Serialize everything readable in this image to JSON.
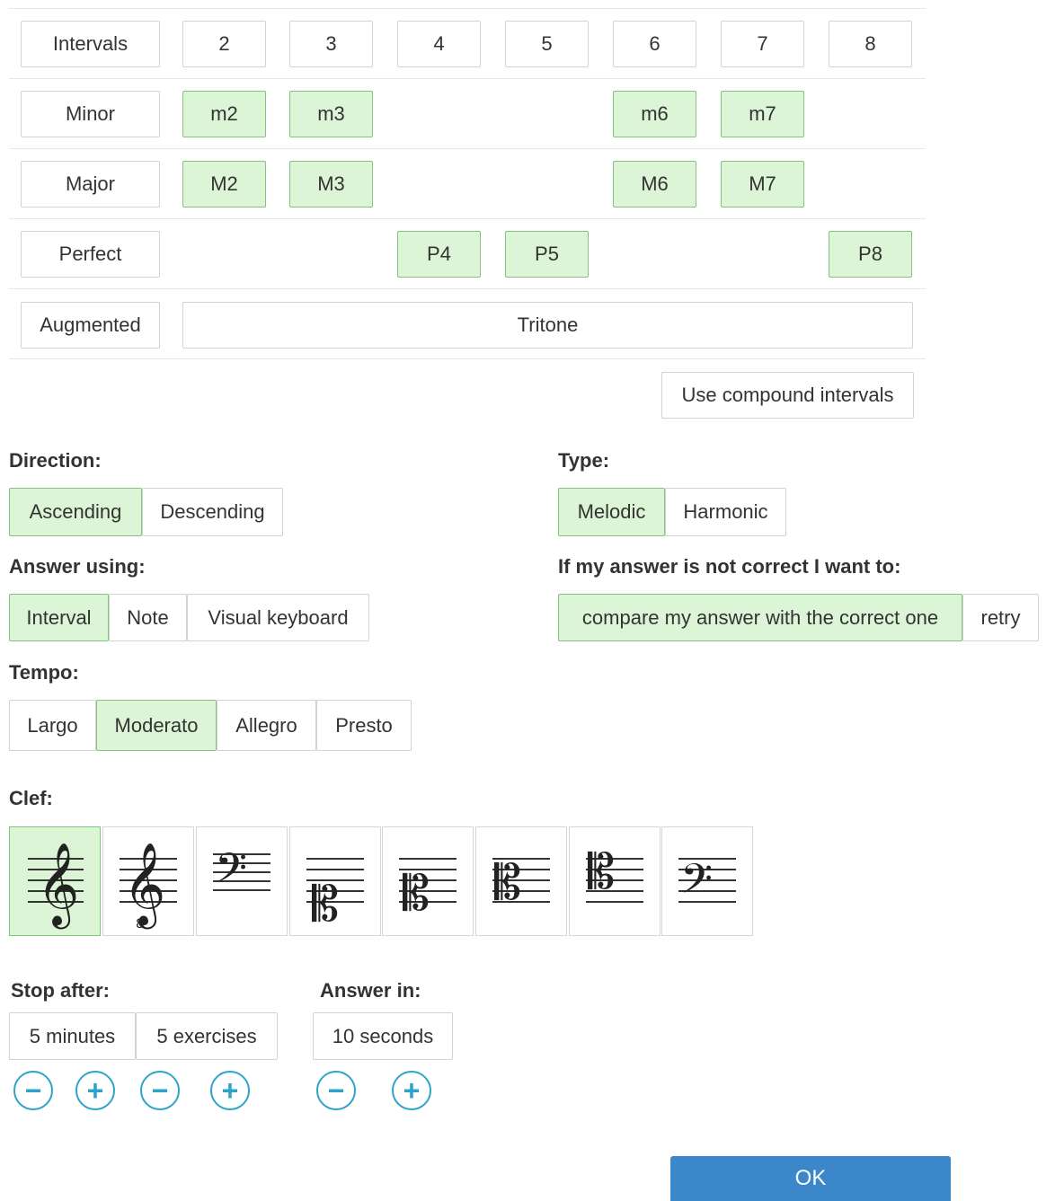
{
  "intervals": {
    "header": [
      "Intervals",
      "2",
      "3",
      "4",
      "5",
      "6",
      "7",
      "8"
    ],
    "minor": {
      "label": "Minor",
      "items": [
        "m2",
        "m3",
        "m6",
        "m7"
      ]
    },
    "major": {
      "label": "Major",
      "items": [
        "M2",
        "M3",
        "M6",
        "M7"
      ]
    },
    "perfect": {
      "label": "Perfect",
      "items": [
        "P4",
        "P5",
        "P8"
      ]
    },
    "augmented": {
      "label": "Augmented",
      "tritone": "Tritone"
    },
    "compound": "Use compound intervals"
  },
  "direction": {
    "label": "Direction:",
    "options": [
      "Ascending",
      "Descending"
    ],
    "selected": "Ascending"
  },
  "type": {
    "label": "Type:",
    "options": [
      "Melodic",
      "Harmonic"
    ],
    "selected": "Melodic"
  },
  "answer_using": {
    "label": "Answer using:",
    "options": [
      "Interval",
      "Note",
      "Visual keyboard"
    ],
    "selected": "Interval"
  },
  "if_wrong": {
    "label": "If my answer is not correct I want to:",
    "options": [
      "compare my answer with the correct one",
      "retry"
    ],
    "selected": "compare my answer with the correct one"
  },
  "tempo": {
    "label": "Tempo:",
    "options": [
      "Largo",
      "Moderato",
      "Allegro",
      "Presto"
    ],
    "selected": "Moderato"
  },
  "clef": {
    "label": "Clef:",
    "options": [
      "treble-clef-icon",
      "treble-8vb-clef-icon",
      "bass-clef-icon",
      "soprano-clef-icon",
      "mezzo-soprano-clef-icon",
      "alto-clef-icon",
      "tenor-clef-icon",
      "baritone-clef-icon"
    ],
    "selected": "treble-clef-icon"
  },
  "stop_after": {
    "label": "Stop after:",
    "options": [
      "5 minutes",
      "5 exercises"
    ]
  },
  "answer_in": {
    "label": "Answer in:",
    "value": "10 seconds"
  },
  "stepper": {
    "minus": "−",
    "plus": "+"
  },
  "ok": "OK",
  "colors": {
    "selected_bg": "#dcf5d6",
    "selected_border": "#83c47c",
    "accent": "#2ea3c8",
    "ok": "#3b87c9"
  }
}
